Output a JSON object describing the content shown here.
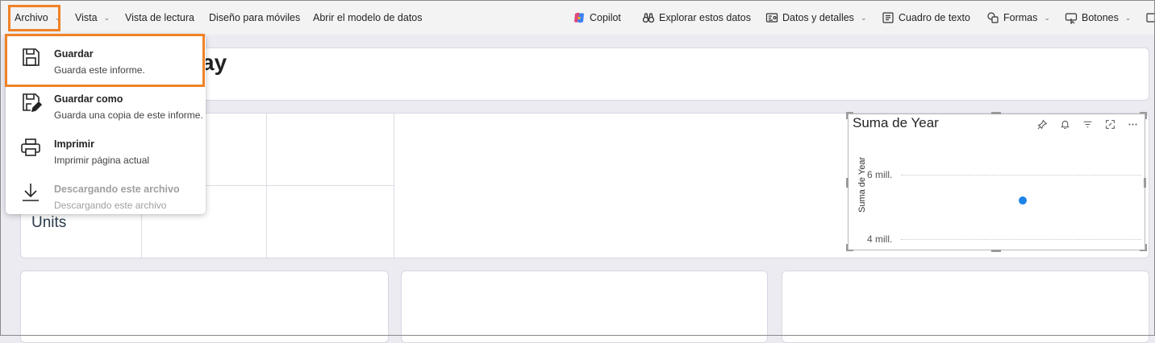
{
  "ribbon": {
    "archivo": "Archivo",
    "vista": "Vista",
    "vista_lectura": "Vista de lectura",
    "diseno_moviles": "Diseño para móviles",
    "abrir_modelo": "Abrir el modelo de datos",
    "copilot": "Copilot",
    "explorar": "Explorar estos datos",
    "datos_detalles": "Datos y detalles",
    "cuadro_texto": "Cuadro de texto",
    "formas": "Formas",
    "botones": "Botones"
  },
  "menu": {
    "items": [
      {
        "title": "Guardar",
        "desc": "Guarda este informe.",
        "icon": "save-icon"
      },
      {
        "title": "Guardar como",
        "desc": "Guarda una copia de este informe.",
        "icon": "save-as-icon"
      },
      {
        "title": "Imprimir",
        "desc": "Imprimir página actual",
        "icon": "printer-icon"
      },
      {
        "title": "Descargando este archivo",
        "desc": "Descargando este archivo",
        "icon": "download-icon",
        "disabled": true
      }
    ]
  },
  "canvas": {
    "title_fragment": "ay",
    "units_label": "Units"
  },
  "visual": {
    "title": "Suma de Year",
    "y_axis_label": "Suma de Year",
    "ticks": [
      "6 mill.",
      "4 mill."
    ]
  },
  "colors": {
    "highlight": "#f08226",
    "data_point": "#1e84e6"
  }
}
